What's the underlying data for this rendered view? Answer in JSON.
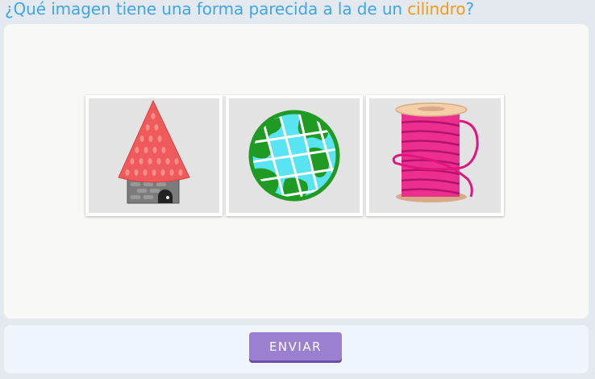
{
  "question": {
    "prefix": "¿Qué imagen tiene una forma parecida a la de un ",
    "highlight": "cilindro",
    "suffix": "?"
  },
  "options": [
    {
      "icon": "cone-roof-house-icon"
    },
    {
      "icon": "globe-icon"
    },
    {
      "icon": "thread-spool-icon"
    }
  ],
  "submit_button": {
    "label": "ENVIAR"
  },
  "colors": {
    "question": "#3fa6e6",
    "highlight": "#f39a16",
    "button": "#9b7fd0",
    "footer": "#eef5fd"
  }
}
